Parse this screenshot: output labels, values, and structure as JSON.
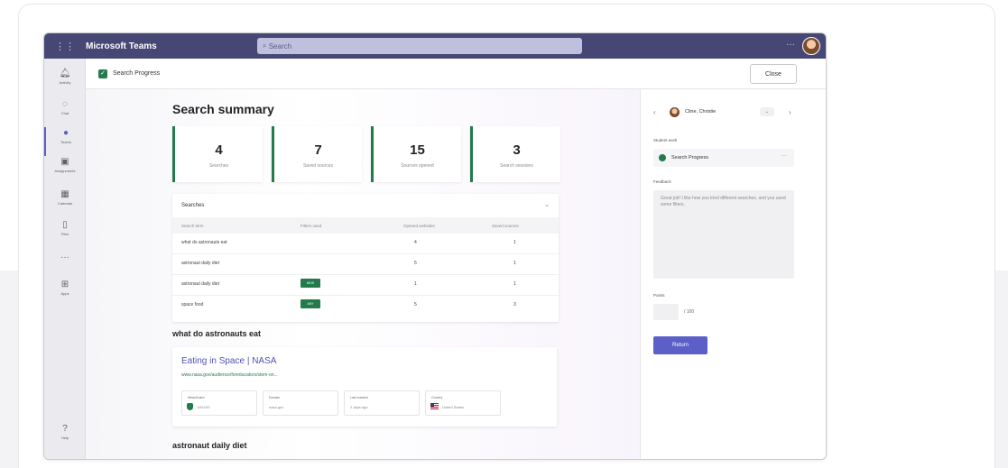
{
  "titlebar": {
    "app_title": "Microsoft Teams",
    "search_placeholder": "Search",
    "more": "···"
  },
  "rail": {
    "items": [
      {
        "label": "Activity"
      },
      {
        "label": "Chat"
      },
      {
        "label": "Teams"
      },
      {
        "label": "Assignments"
      },
      {
        "label": "Calendar"
      },
      {
        "label": "Files"
      },
      {
        "label": "···"
      },
      {
        "label": "Apps"
      },
      {
        "label": "Help"
      }
    ]
  },
  "header": {
    "app_name": "Search Progress",
    "close_label": "Close"
  },
  "summary": {
    "title": "Search summary",
    "stats": [
      {
        "value": "4",
        "label": "Searches"
      },
      {
        "value": "7",
        "label": "Saved sources"
      },
      {
        "value": "15",
        "label": "Sources opened"
      },
      {
        "value": "3",
        "label": "Search sessions"
      }
    ]
  },
  "searches": {
    "title": "Searches",
    "columns": [
      "Search term",
      "Filters used",
      "Opened websites",
      "Saved sources"
    ],
    "rows": [
      {
        "term": "what do astronauts eat",
        "filter": "",
        "opened": "4",
        "saved": "1"
      },
      {
        "term": "astronaut daily diet",
        "filter": "",
        "opened": "5",
        "saved": "1"
      },
      {
        "term": "astronaut daily diet",
        "filter": "NEW",
        "opened": "1",
        "saved": "1"
      },
      {
        "term": "space food",
        "filter": "ANY",
        "opened": "5",
        "saved": "3"
      }
    ]
  },
  "result_section": {
    "title": "what do astronauts eat",
    "result_title": "Eating in Space | NASA",
    "result_url": "www.nasa.gov/audience/foreducators/stem-on...",
    "meta": [
      {
        "key": "NewsGuard",
        "value": "100/100"
      },
      {
        "key": "Domain",
        "value": "nasa.gov"
      },
      {
        "key": "Last crawled",
        "value": "2 days ago"
      },
      {
        "key": "Country",
        "value": "United States"
      }
    ]
  },
  "next_section": {
    "title": "astronaut daily diet"
  },
  "grading": {
    "student_name": "Cline, Christie",
    "student_work_label": "Student work",
    "work_item": "Search Progress",
    "feedback_label": "Feedback",
    "feedback_text": "Great job! I like how you tried different searches, and you used some filters.",
    "points_label": "Points",
    "points_max": "/ 100",
    "return_label": "Return"
  }
}
